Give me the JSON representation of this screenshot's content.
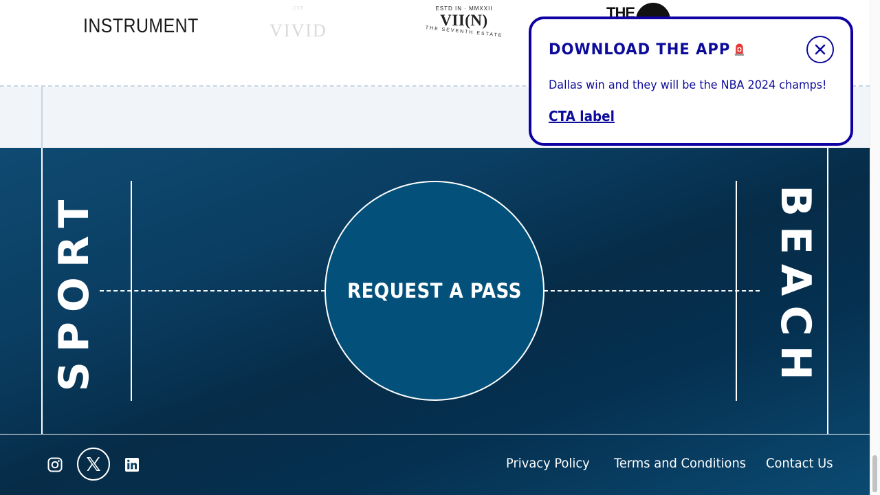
{
  "logos": {
    "instrument": "INSTRUMENT",
    "faded_logo": {
      "big": "VIVID",
      "small": "EST"
    },
    "vii_n": {
      "top": "ESTD IN  ·  MMXXII",
      "main": "VII(N)",
      "bottom": "THE SEVENTH ESTATE"
    },
    "the_logo": "THE"
  },
  "court": {
    "left_word": "SPORT",
    "right_word": "BEACH",
    "cta": "REQUEST A PASS"
  },
  "footer": {
    "social": [
      {
        "icon": "instagram-icon"
      },
      {
        "icon": "x-icon"
      },
      {
        "icon": "linkedin-icon"
      }
    ],
    "links": {
      "privacy": "Privacy Policy",
      "terms": "Terms and Conditions",
      "contact": "Contact Us"
    }
  },
  "popup": {
    "title": "DOWNLOAD THE APP",
    "emoji_icon": "siren-icon",
    "body": "Dallas win and they will be the NBA 2024 champs!",
    "cta": "CTA label",
    "close_icon": "close-icon"
  },
  "colors": {
    "popup_accent": "#0e00a3",
    "court_blue": "#0a3d61",
    "circle_fill": "#03507a"
  }
}
